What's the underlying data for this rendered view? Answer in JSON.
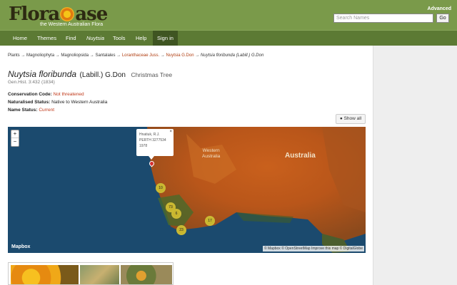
{
  "header": {
    "logo_text_1": "Flora",
    "logo_text_2": "ase",
    "logo_tagline": "the Western Australian Flora",
    "advanced_label": "Advanced",
    "search_placeholder": "Search Names",
    "go_label": "Go"
  },
  "nav": {
    "items": [
      {
        "label": "Home"
      },
      {
        "label": "Themes"
      },
      {
        "label": "Find"
      },
      {
        "label": "Nuytsia"
      },
      {
        "label": "Tools"
      },
      {
        "label": "Help"
      },
      {
        "label": "Sign in"
      }
    ]
  },
  "breadcrumb": {
    "items": [
      "Plants",
      "Magnoliophyta",
      "Magnoliopsida",
      "Santalales",
      "Loranthaceae Juss.",
      "Nuytsia G.Don",
      "Nuytsia floribunda (Labill.) G.Don"
    ],
    "separator": "→"
  },
  "taxon": {
    "scientific_name": "Nuytsia floribunda",
    "authority": "(Labill.) G.Don",
    "common_name": "Christmas Tree",
    "publication": "Gen.Hist. 3:432 (1834)"
  },
  "status": {
    "conservation_label": "Conservation Code:",
    "conservation_value": "Not threatened",
    "naturalised_label": "Naturalised Status:",
    "naturalised_value": "Native to Western Australia",
    "name_status_label": "Name Status:",
    "name_status_value": "Current"
  },
  "show_all_label": "Show all",
  "map": {
    "zoom_in": "+",
    "zoom_out": "−",
    "labels": {
      "western_australia": "Western\nAustralia",
      "australia": "Australia"
    },
    "popup": {
      "line1": "Hnatiuk, R.J.",
      "line2": "PERTH 3277534",
      "line3": "1978",
      "close": "×"
    },
    "clusters": [
      {
        "count": "10"
      },
      {
        "count": "73"
      },
      {
        "count": "6"
      },
      {
        "count": "23"
      },
      {
        "count": "17"
      }
    ],
    "brand": "Mapbox",
    "attribution": "© Mapbox © OpenStreetMap Improve this map © DigitalGlobe"
  }
}
